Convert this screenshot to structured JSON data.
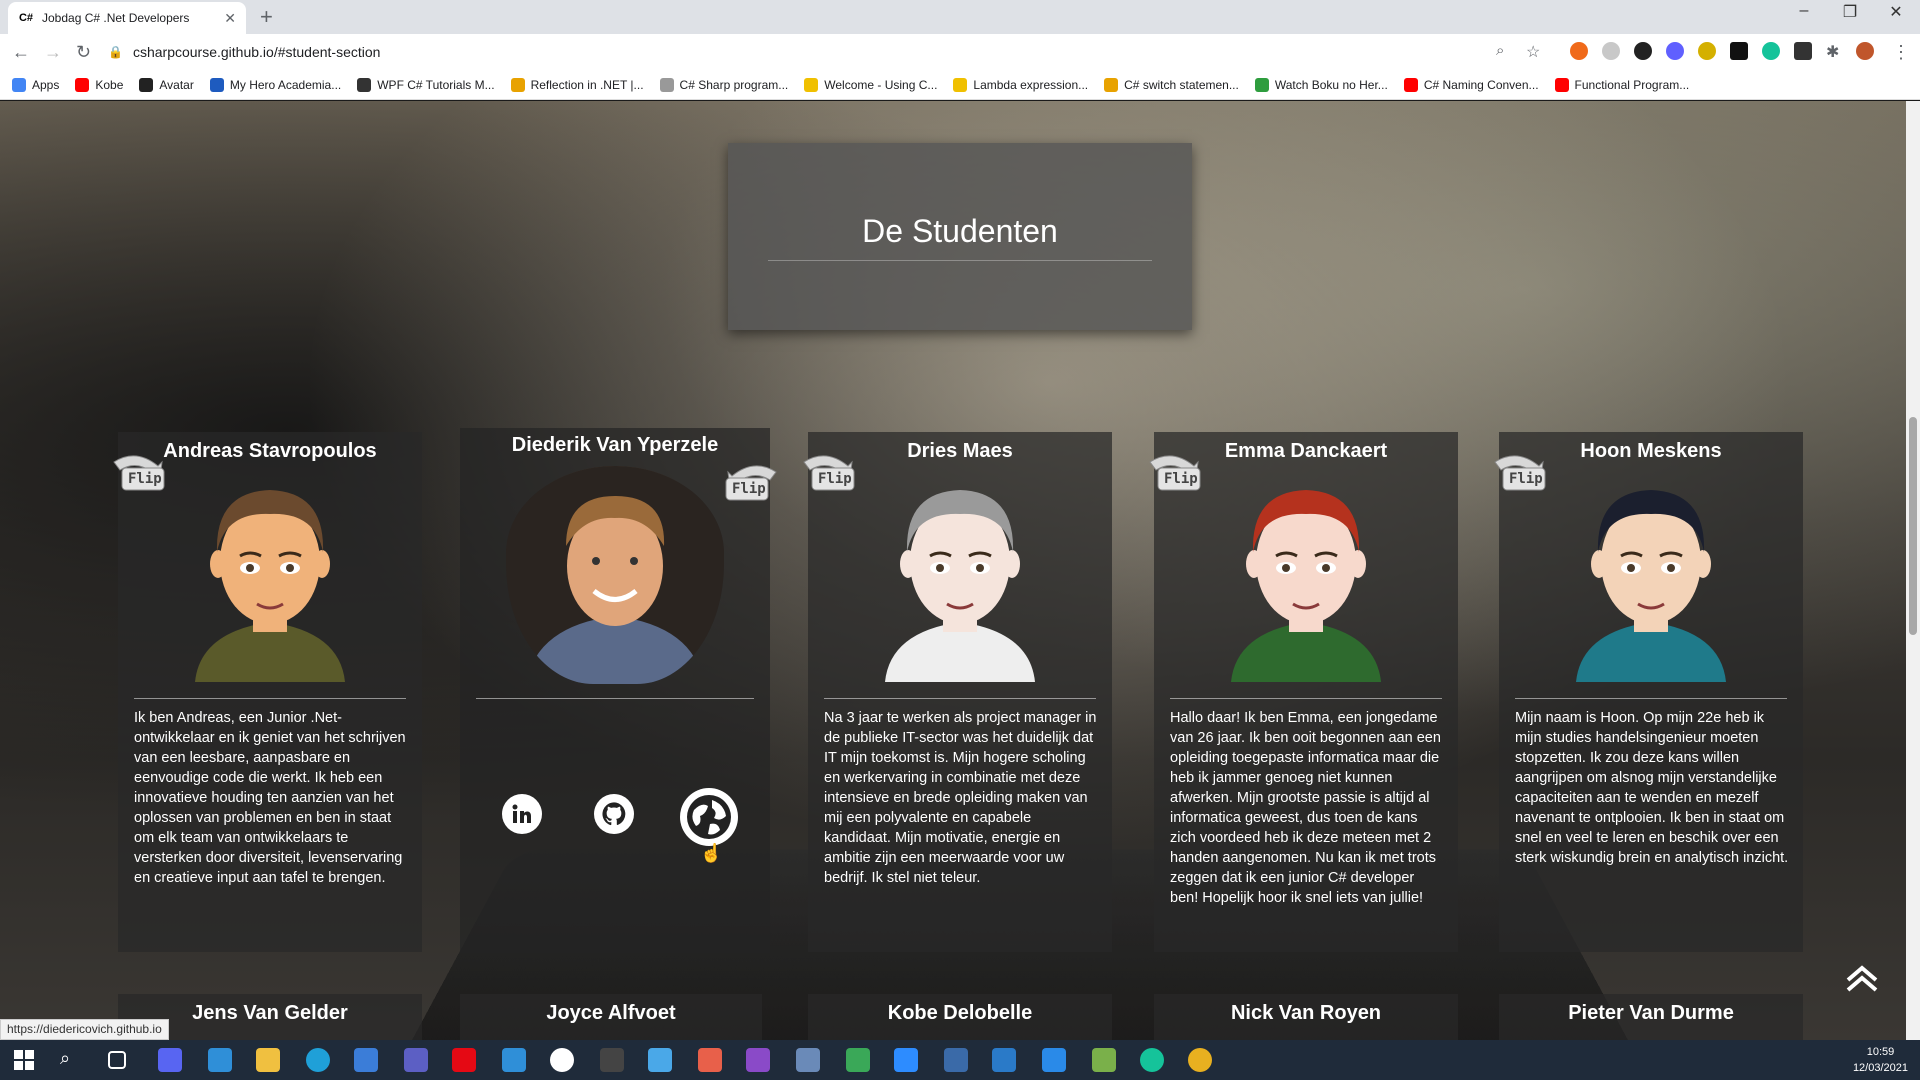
{
  "browser": {
    "tab_title": "Jobdag C# .Net Developers",
    "tab_favicon": "C#",
    "url": "csharpcourse.github.io/#student-section",
    "bookmarks": [
      {
        "label": "Apps",
        "color": "#4285f4"
      },
      {
        "label": "Kobe",
        "color": "#ff0000"
      },
      {
        "label": "Avatar",
        "color": "#222222"
      },
      {
        "label": "My Hero Academia...",
        "color": "#1e5bbf"
      },
      {
        "label": "WPF C# Tutorials M...",
        "color": "#333333"
      },
      {
        "label": "Reflection in .NET |...",
        "color": "#e8a200"
      },
      {
        "label": "C# Sharp program...",
        "color": "#999999"
      },
      {
        "label": "Welcome - Using C...",
        "color": "#f0c000"
      },
      {
        "label": "Lambda expression...",
        "color": "#f0c000"
      },
      {
        "label": "C# switch statemen...",
        "color": "#e8a200"
      },
      {
        "label": "Watch Boku no Her...",
        "color": "#2e9d3e"
      },
      {
        "label": "C# Naming Conven...",
        "color": "#ff0000"
      },
      {
        "label": "Functional Program...",
        "color": "#ff0000"
      }
    ]
  },
  "section": {
    "title": "De Studenten"
  },
  "flip_label": "Flip",
  "students": [
    {
      "name": "Andreas Stavropoulos",
      "bio": "Ik ben Andreas, een Junior .Net-ontwikkelaar en ik geniet van het schrijven van een leesbare, aanpasbare en eenvoudige code die werkt. Ik heb een innovatieve houding ten aanzien van het oplossen van problemen en ben in staat om elk team van ontwikkelaars te versterken door diversiteit, levenservaring en creatieve input aan tafel te brengen.",
      "hair": "#6b4a2e",
      "skin": "#f0b27a",
      "shirt": "#5a5a2a"
    },
    {
      "name": "Diederik Van Yperzele",
      "bio": "",
      "social": [
        "in",
        "github",
        "globe"
      ]
    },
    {
      "name": "Dries Maes",
      "bio": "Na 3 jaar te werken als project manager in de publieke IT-sector was het duidelijk dat IT mijn toekomst is. Mijn hogere scholing en werkervaring in combinatie met deze intensieve en brede opleiding maken van mij een polyvalente en capabele kandidaat. Mijn motivatie, energie en ambitie zijn een meerwaarde voor uw bedrijf. Ik stel niet teleur.",
      "hair": "#9a9a9a",
      "skin": "#f5e4dc",
      "shirt": "#eeeeee"
    },
    {
      "name": "Emma Danckaert",
      "bio": "Hallo daar! Ik ben Emma, een jongedame van 26 jaar. Ik ben ooit begonnen aan een opleiding toegepaste informatica maar die heb ik jammer genoeg niet kunnen afwerken. Mijn grootste passie is altijd al informatica geweest, dus toen de kans zich voordeed heb ik deze meteen met 2 handen aangenomen. Nu kan ik met trots zeggen dat ik een junior C# developer ben! Hopelijk hoor ik snel iets van jullie!",
      "hair": "#b5321e",
      "skin": "#f7d9cc",
      "shirt": "#2e6a2e"
    },
    {
      "name": "Hoon Meskens",
      "bio": "Mijn naam is Hoon. Op mijn 22e heb ik mijn studies handelsingenieur moeten stopzetten. Ik zou deze kans willen aangrijpen om alsnog mijn verstandelijke capaciteiten aan te wenden en mezelf navenant te ontplooien. Ik ben in staat om snel en veel te leren en beschik over een sterk wiskundig brein en analytisch inzicht.",
      "hair": "#1b1f2e",
      "skin": "#f3d3b8",
      "shirt": "#1f7a8a"
    }
  ],
  "next_row": [
    "Jens Van Gelder",
    "Joyce Alfvoet",
    "Kobe Delobelle",
    "Nick Van Royen",
    "Pieter Van Durme"
  ],
  "status_url": "https://diedericovich.github.io",
  "clock": {
    "time": "10:59",
    "date": "12/03/2021"
  }
}
